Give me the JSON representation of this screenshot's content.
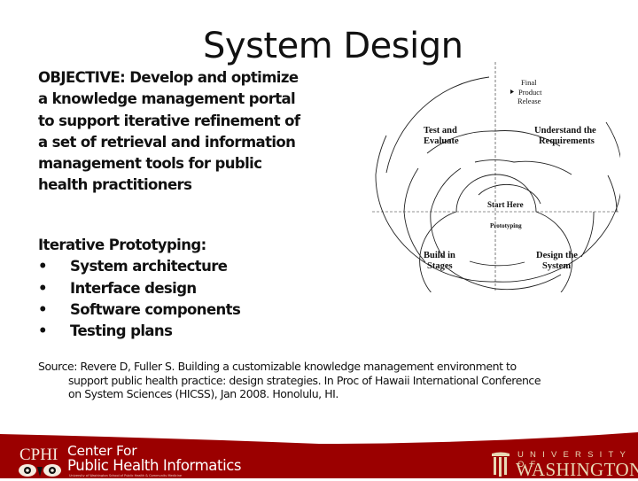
{
  "slide": {
    "title": "System Design",
    "objective": "OBJECTIVE:  Develop and optimize a knowledge management portal to support iterative refinement of a set of retrieval and information management tools for public health practitioners",
    "prototyping": {
      "heading": "Iterative Prototyping:",
      "bullet_glyph": "•",
      "items": [
        "System architecture",
        "Interface design",
        "Software components",
        "Testing plans"
      ]
    },
    "source": {
      "line1": "Source: Revere D, Fuller S. Building a customizable knowledge management environment to",
      "line2": "support public health practice: design strategies. In Proc of Hawaii International Conference",
      "line3": "on System Sciences (HICSS), Jan 2008. Honolulu, HI."
    }
  },
  "diagram": {
    "final_release": [
      "Final",
      "Product",
      "Release"
    ],
    "test_evaluate": [
      "Test and",
      "Evaluate"
    ],
    "understand_requirements": [
      "Understand the",
      "Requirements"
    ],
    "start_here": "Start Here",
    "prototyping": "Prototyping",
    "build_stages": [
      "Build in",
      "Stages"
    ],
    "design_system": [
      "Design the",
      "System"
    ]
  },
  "footer": {
    "cphi_abbrev": "CPHI",
    "center_for": "Center For",
    "public_health_informatics": "Public Health Informatics",
    "cphi_subtitle": "University of Washington School of Public Health & Community Medicine",
    "uw_university_of": "UNIVERSITY OF",
    "uw_washington": "WASHINGTON",
    "colors": {
      "footer_red": "#9b0000",
      "uw_gold": "#e8d9b5"
    }
  }
}
